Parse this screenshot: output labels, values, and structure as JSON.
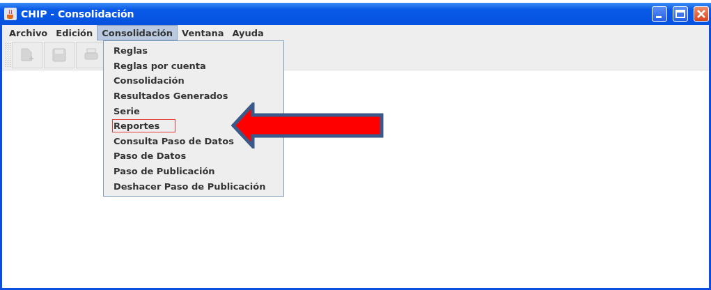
{
  "window": {
    "title": "CHIP - Consolidación"
  },
  "menu_bar": [
    {
      "label": "Archivo",
      "selected": false
    },
    {
      "label": "Edición",
      "selected": false
    },
    {
      "label": "Consolidación",
      "selected": true
    },
    {
      "label": "Ventana",
      "selected": false
    },
    {
      "label": "Ayuda",
      "selected": false
    }
  ],
  "toolbar": [
    {
      "kind": "new",
      "disabled": true
    },
    {
      "kind": "save",
      "disabled": true
    },
    {
      "kind": "print",
      "disabled": true
    }
  ],
  "dropdown_menu": [
    {
      "label": "Reglas",
      "highlighted": false
    },
    {
      "label": "Reglas por cuenta",
      "highlighted": false
    },
    {
      "label": "Consolidación",
      "highlighted": false
    },
    {
      "label": "Resultados Generados",
      "highlighted": false
    },
    {
      "label": "Serie",
      "highlighted": false
    },
    {
      "label": "Reportes",
      "highlighted": true
    },
    {
      "label": "Consulta Paso de Datos",
      "highlighted": false
    },
    {
      "label": "Paso de Datos",
      "highlighted": false
    },
    {
      "label": "Paso de Publicación",
      "highlighted": false
    },
    {
      "label": "Deshacer Paso de Publicación",
      "highlighted": false
    }
  ]
}
